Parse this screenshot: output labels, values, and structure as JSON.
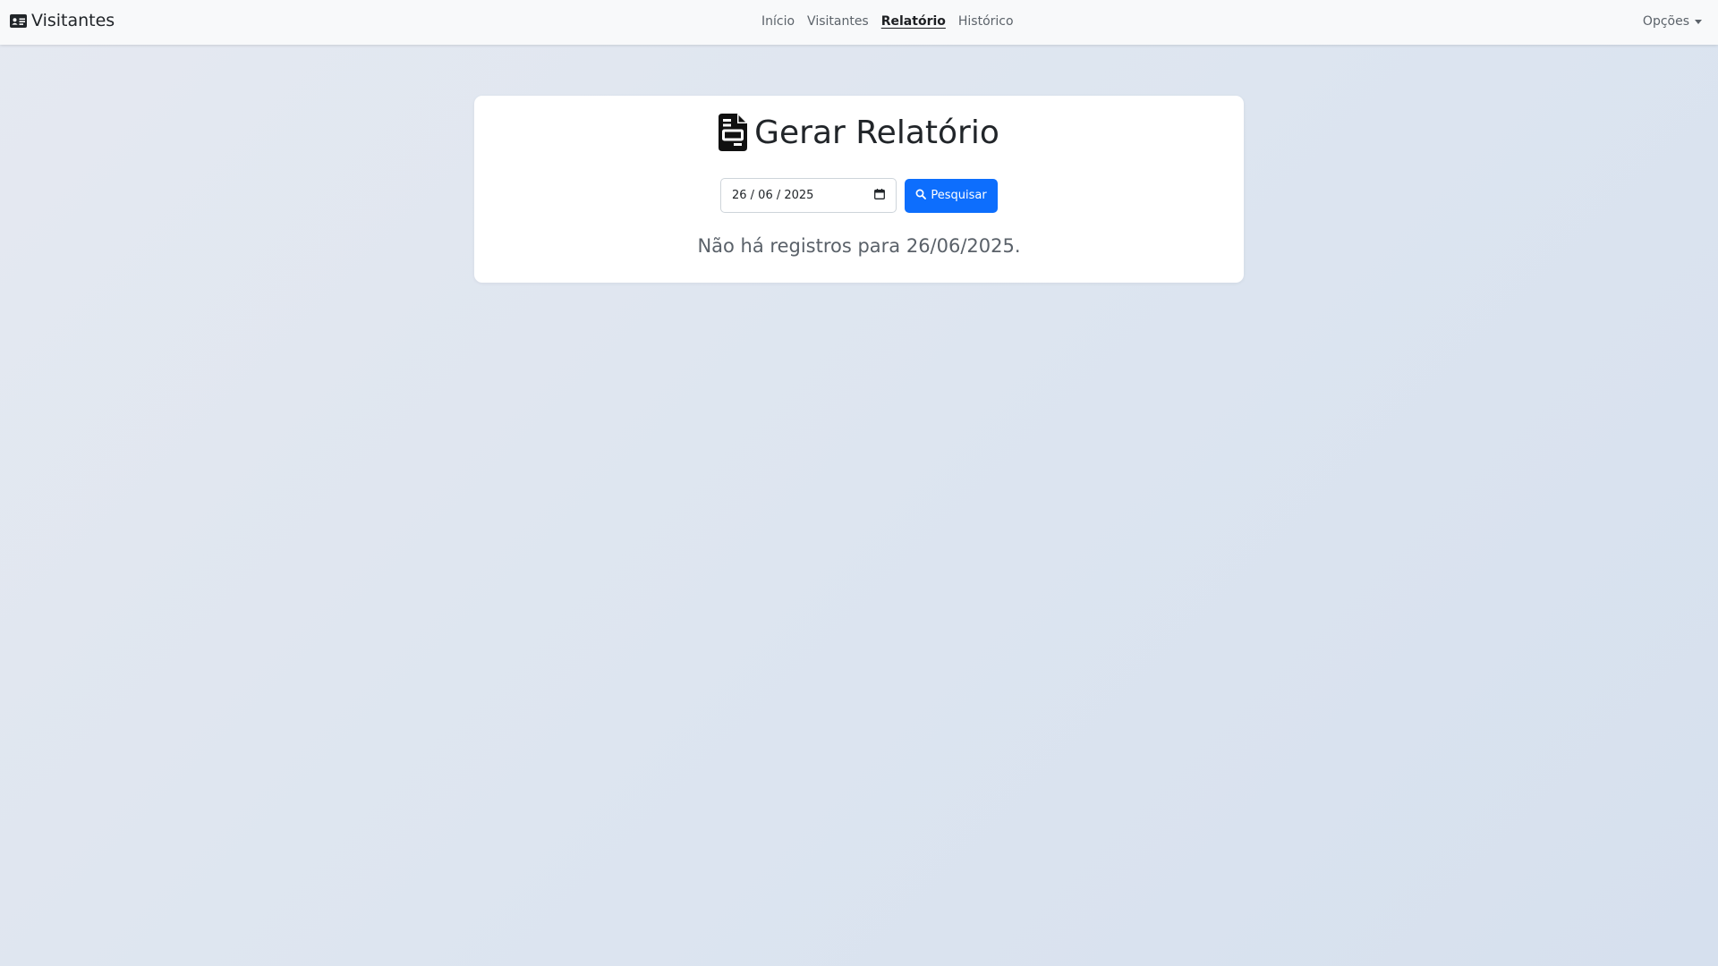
{
  "navbar": {
    "brand": "Visitantes",
    "brand_icon": "id-card-icon",
    "links": [
      {
        "label": "Início",
        "active": false
      },
      {
        "label": "Visitantes",
        "active": false
      },
      {
        "label": "Relatório",
        "active": true
      },
      {
        "label": "Histórico",
        "active": false
      }
    ],
    "options_label": "Opções"
  },
  "report": {
    "title": "Gerar Relatório",
    "title_icon": "file-invoice-icon",
    "date_value": "26 / 06 / 2025",
    "search_label": "Pesquisar",
    "search_icon": "search-icon",
    "empty_message": "Não há registros para 26/06/2025."
  },
  "colors": {
    "primary": "#0d6efd",
    "navbar_bg": "#f8f9fa",
    "page_bg": "#dde5f0"
  }
}
